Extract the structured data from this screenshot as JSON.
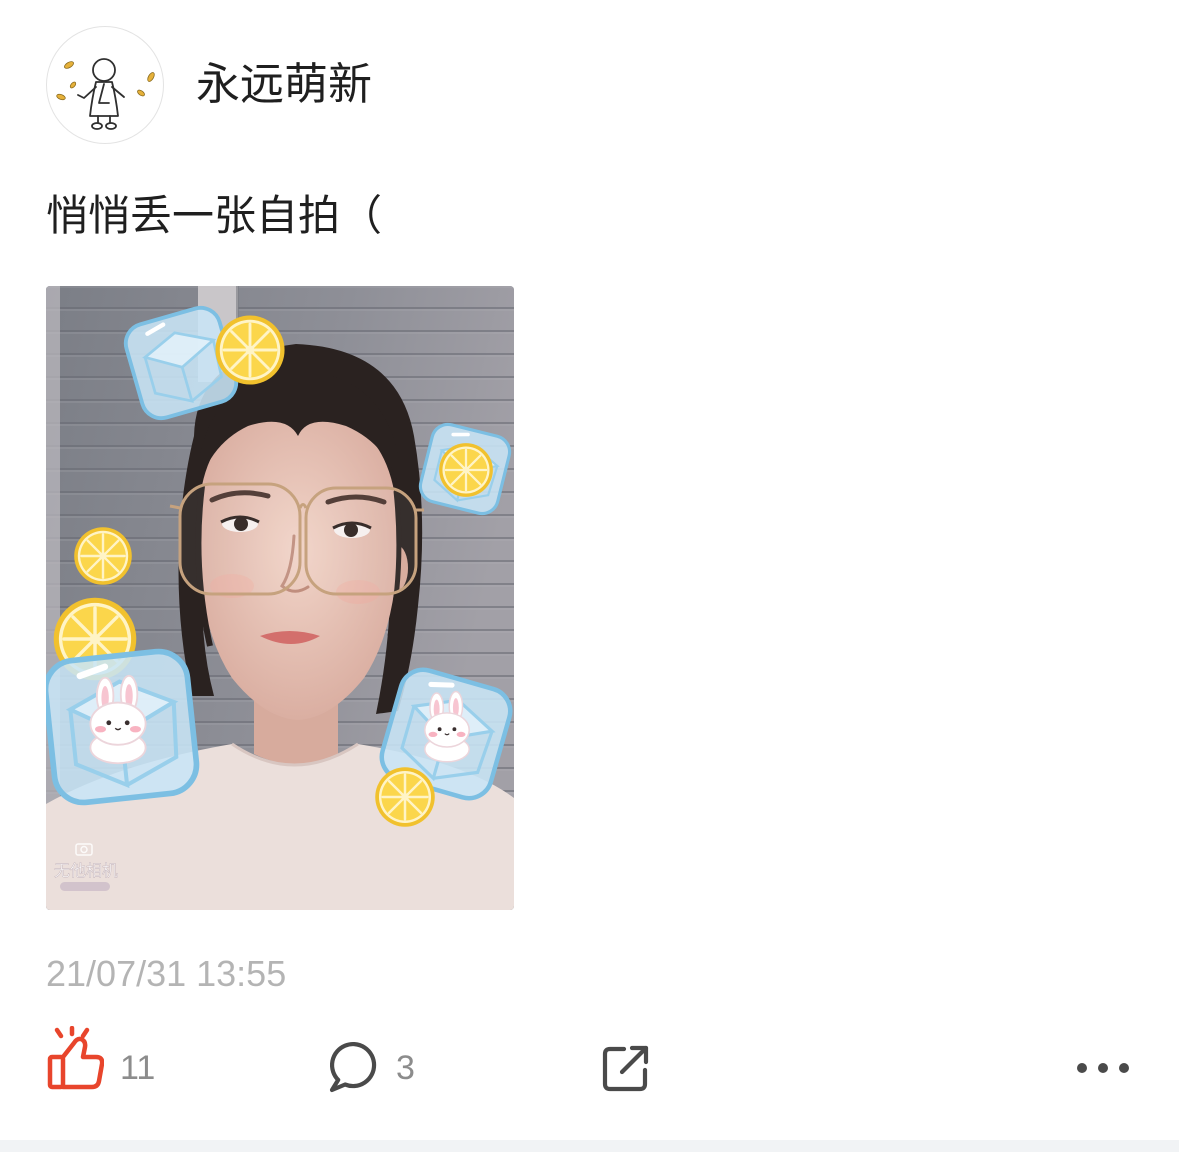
{
  "post": {
    "author": {
      "name": "永远萌新",
      "avatar_icon": "stick-figure-avatar-icon"
    },
    "text": "悄悄丢一张自拍（",
    "photo": {
      "watermark": "无他相机"
    },
    "timestamp": "21/07/31 13:55"
  },
  "actions": {
    "like": {
      "icon": "thumbs-up-icon",
      "count": "11",
      "liked": true
    },
    "comment": {
      "icon": "comment-icon",
      "count": "3"
    },
    "share": {
      "icon": "share-icon"
    },
    "more": {
      "icon": "more-icon"
    }
  },
  "colors": {
    "text": "#1f1f1f",
    "timestamp": "#b4b4b4",
    "count": "#8c8c8c",
    "icon": "#4a4a4a",
    "like_active": "#e8452c",
    "bottom_strip": "#f1f3f5"
  }
}
